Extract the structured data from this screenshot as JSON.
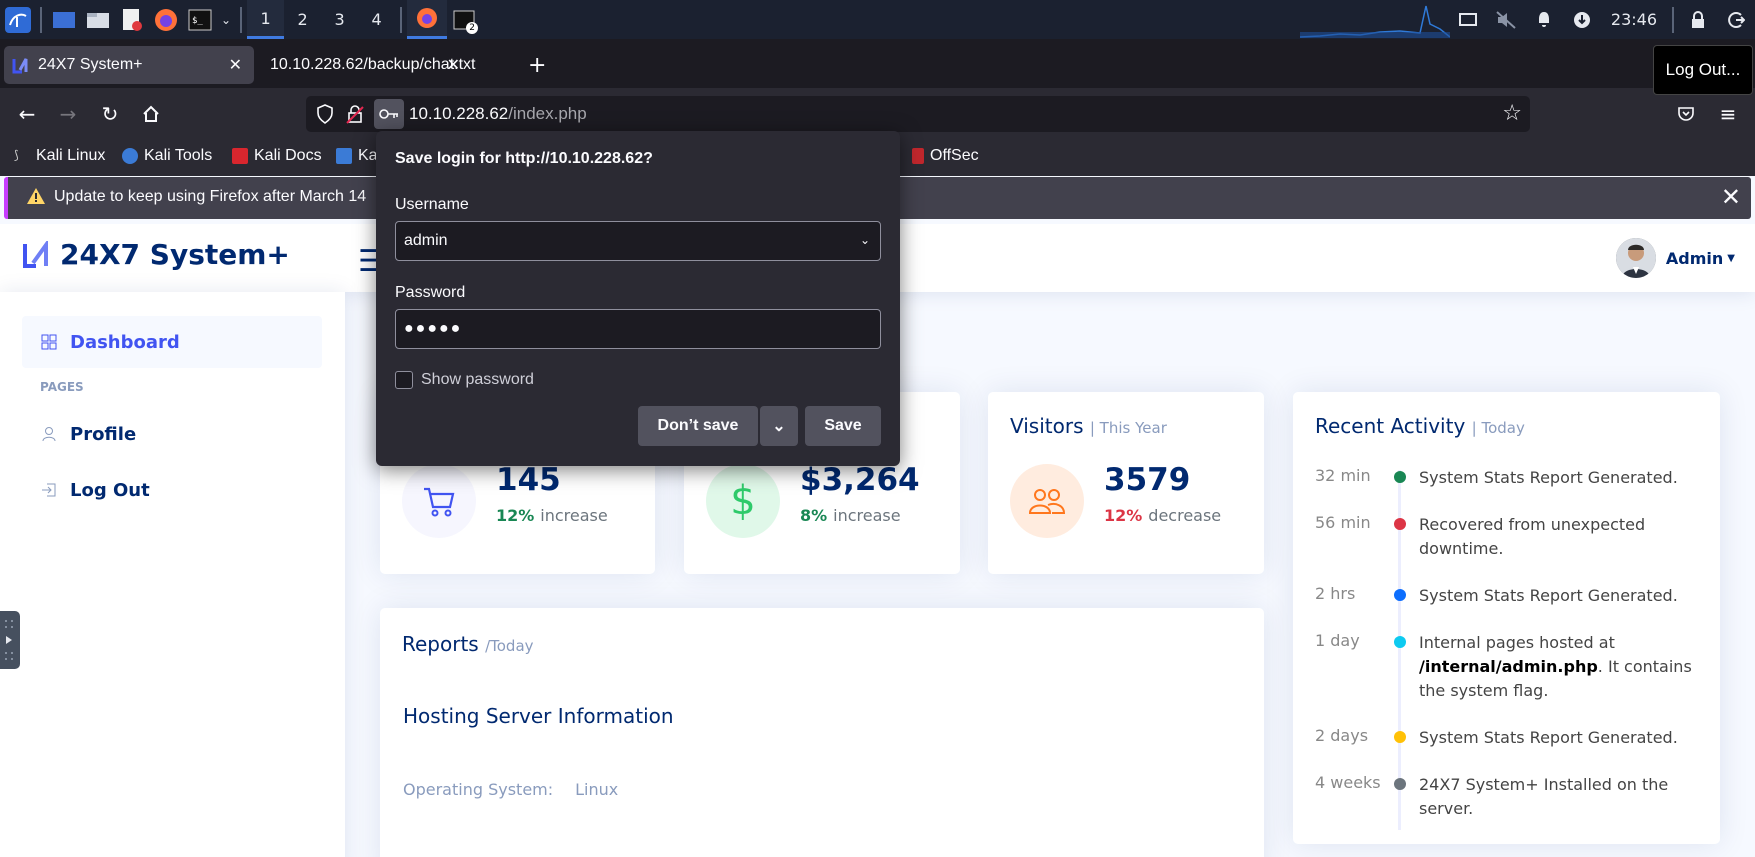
{
  "taskbar": {
    "workspaces": [
      "1",
      "2",
      "3",
      "4"
    ],
    "clock": "23:46",
    "terminal_badge": "2"
  },
  "browser": {
    "tabs": [
      {
        "title": "24X7 System+"
      },
      {
        "title": "10.10.228.62/backup/chat.txt"
      }
    ],
    "url_host": "10.10.228.62",
    "url_path": "/index.php",
    "tooltip": "Log Out...",
    "bookmarks": [
      "Kali Linux",
      "Kali Tools",
      "Kali Docs",
      "Ka",
      "OffSec"
    ],
    "notification": "Update to keep using Firefox after March 14"
  },
  "save_login": {
    "title": "Save login for http://10.10.228.62?",
    "username_label": "Username",
    "username_value": "admin",
    "password_label": "Password",
    "password_value": "●●●●●",
    "show_password": "Show password",
    "dont_save": "Don’t save",
    "save": "Save"
  },
  "app": {
    "logo": "24X7 System+",
    "user": "Admin",
    "sidebar": {
      "dashboard": "Dashboard",
      "section": "PAGES",
      "profile": "Profile",
      "logout": "Log Out"
    },
    "cards": {
      "sales": {
        "value": "145",
        "pct": "12%",
        "word": "increase"
      },
      "revenue": {
        "value": "$3,264",
        "pct": "8%",
        "word": "increase"
      },
      "visitors": {
        "title": "Visitors",
        "period": "| This Year",
        "value": "3579",
        "pct": "12%",
        "word": "decrease"
      }
    },
    "reports": {
      "title": "Reports",
      "period": "/Today",
      "hosting": "Hosting Server Information",
      "os_label": "Operating System:",
      "os_value": "Linux"
    },
    "activity": {
      "title": "Recent Activity",
      "period": "| Today",
      "items": [
        {
          "time": "32 min",
          "text": "System Stats Report Generated.",
          "color": "#198754"
        },
        {
          "time": "56 min",
          "text": "Recovered from unexpected downtime.",
          "color": "#dc3545"
        },
        {
          "time": "2 hrs",
          "text": "System Stats Report Generated.",
          "color": "#0d6efd"
        },
        {
          "time": "1 day",
          "text_pre": "Internal pages hosted at ",
          "text_bold": "/internal/admin.php",
          "text_post": ". It contains the system flag.",
          "color": "#0dcaf0"
        },
        {
          "time": "2 days",
          "text": "System Stats Report Generated.",
          "color": "#ffc107"
        },
        {
          "time": "4 weeks",
          "text": "24X7 System+ Installed on the server.",
          "color": "#6c757d"
        }
      ]
    }
  },
  "colors": {
    "accent": "#4154f1",
    "navy": "#012970",
    "green": "#198754",
    "red": "#dc3545"
  }
}
